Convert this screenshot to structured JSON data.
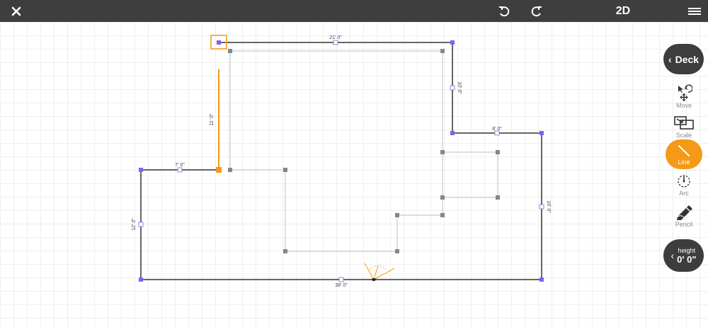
{
  "header": {
    "close_icon": "close-icon",
    "undo_icon": "undo-icon",
    "redo_icon": "redo-icon",
    "mode_label": "2D",
    "menu_icon": "hamburger-menu-icon"
  },
  "plan": {
    "dimensions": {
      "top_wall": "21' 0\"",
      "right_upper_wall": "10' 0\"",
      "right_step_wall": "8' 0\"",
      "right_lower_wall": "16' 0\"",
      "bottom_wall": "38' 0\"",
      "left_wall": "12' 0\"",
      "left_step_wall": "7' 0\"",
      "active_line": "11' 0\""
    },
    "colors": {
      "wall": "#333333",
      "inner_line": "#c9d0d0",
      "vertex": "#8b5cf6",
      "inner_vertex": "#7d8a8a",
      "active": "#f59a16"
    }
  },
  "toolbar": {
    "deck_label": "Deck",
    "tools": [
      {
        "label": "Move",
        "icon": "move-icon"
      },
      {
        "label": "Scale",
        "icon": "scale-icon"
      },
      {
        "label": "Line",
        "icon": "line-icon",
        "active": true
      },
      {
        "label": "Arc",
        "icon": "arc-icon"
      },
      {
        "label": "Pencil",
        "icon": "pencil-icon"
      }
    ],
    "height_label": "height",
    "height_value": "0' 0\""
  }
}
